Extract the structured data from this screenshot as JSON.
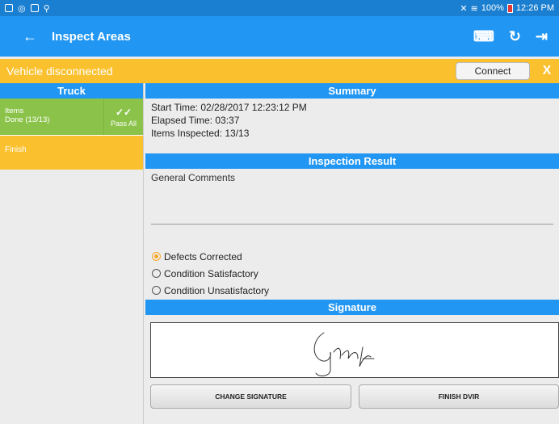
{
  "status_bar": {
    "time": "12:26 PM",
    "battery": "100%",
    "left_icons": [
      "screen-icon",
      "location-icon",
      "image-icon",
      "usb-icon"
    ],
    "right_icons": [
      "bluetooth-off-icon",
      "wifi-icon",
      "battery-icon"
    ]
  },
  "app_bar": {
    "title": "Inspect Areas",
    "back_icon": "arrow-left-icon",
    "actions": [
      "driver-icon",
      "refresh-icon",
      "logout-icon"
    ]
  },
  "alert": {
    "message": "Vehicle disconnected",
    "connect_label": "Connect",
    "close_label": "X"
  },
  "left_panel": {
    "header": "Truck",
    "items": {
      "title": "Items",
      "status": "Done (13/13)",
      "pass_all_label": "Pass All"
    },
    "finish_label": "Finish"
  },
  "summary": {
    "header": "Summary",
    "start_time": "Start Time: 02/28/2017 12:23:12 PM",
    "elapsed_time": "Elapsed Time: 03:37",
    "items_inspected": "Items Inspected: 13/13"
  },
  "inspection_result": {
    "header": "Inspection Result",
    "comments_label": "General Comments",
    "options": [
      "Defects Corrected",
      "Condition Satisfactory",
      "Condition Unsatisfactory"
    ],
    "selected": "Defects Corrected"
  },
  "signature": {
    "header": "Signature",
    "change_label": "CHANGE SIGNATURE",
    "finish_label": "FINISH DVIR"
  },
  "colors": {
    "primary": "#2196f3",
    "warning": "#fbc02d",
    "success": "#8bc34a",
    "radio_selected": "#f9a825"
  }
}
